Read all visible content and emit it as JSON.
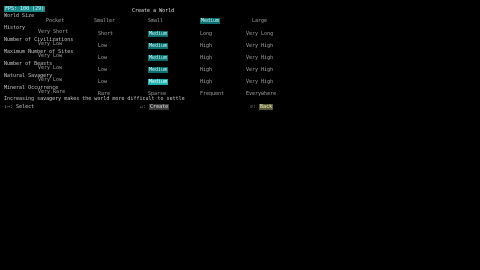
{
  "fps": "FPS: 100 (29)",
  "title": "Create a World",
  "rows": [
    {
      "label": "World Size",
      "sub": "",
      "opts": [
        "Pocket",
        "Smaller",
        "Small",
        "Medium",
        "Large"
      ],
      "sel": 3,
      "hi": -1
    },
    {
      "label": "History",
      "sub": "Very Short",
      "opts": [
        "Short",
        "Medium",
        "Long",
        "Very Long"
      ],
      "sel": 1,
      "hi": -1
    },
    {
      "label": "Number of Civilizations",
      "sub": "Very Low",
      "opts": [
        "Low",
        "Medium",
        "High",
        "Very High"
      ],
      "sel": 1,
      "hi": -1
    },
    {
      "label": "Maximum Number of Sites",
      "sub": "Very Low",
      "opts": [
        "Low",
        "Medium",
        "High",
        "Very High"
      ],
      "sel": 1,
      "hi": -1
    },
    {
      "label": "Number of Beasts",
      "sub": "Very Low",
      "opts": [
        "Low",
        "Medium",
        "High",
        "Very High"
      ],
      "sel": 1,
      "hi": -1
    },
    {
      "label": "Natural Savagery",
      "sub": "Very Low",
      "opts": [
        "Low",
        "Medium",
        "High",
        "Very High"
      ],
      "sel": 1,
      "hi": 1
    },
    {
      "label": "Mineral Occurrence",
      "sub": "Very Rare",
      "opts": [
        "Rare",
        "Sparse",
        "Frequent",
        "Everywhere"
      ],
      "sel": -1,
      "hi": -1
    }
  ],
  "hint": "Increasing savagery makes the world more difficult to settle",
  "footer": {
    "left": "Select",
    "mid": "Create",
    "right": "Back"
  }
}
